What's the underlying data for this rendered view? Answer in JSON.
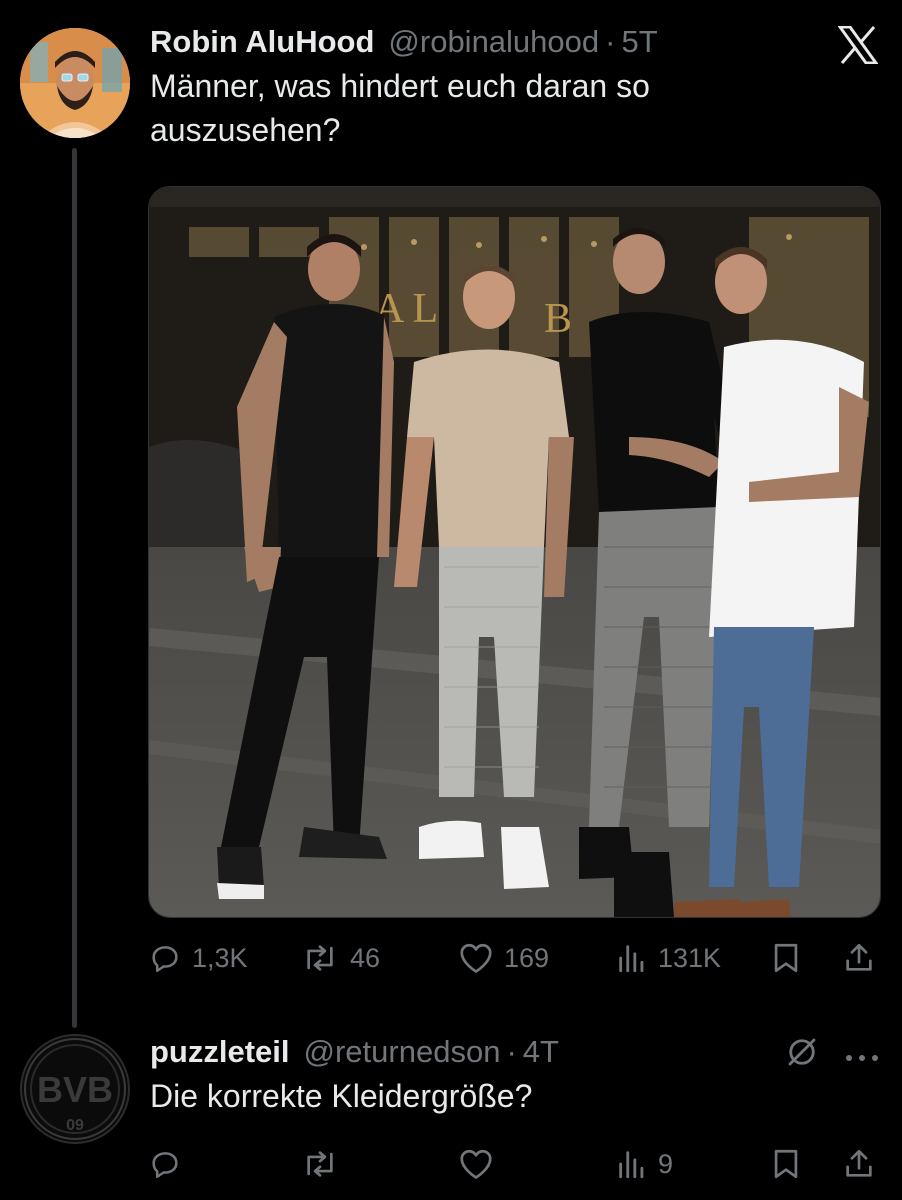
{
  "post": {
    "author_name": "Robin AluHood",
    "handle": "@robinaluhood",
    "separator": "·",
    "time": "5T",
    "text": "Männer, was hindert euch daran so auszusehen?",
    "stats": {
      "replies": "1,3K",
      "reposts": "46",
      "likes": "169",
      "views": "131K"
    }
  },
  "reply": {
    "author_name": "puzzleteil",
    "handle": "@returnedson",
    "separator": "·",
    "time": "4T",
    "text": "Die korrekte Kleidergröße?",
    "avatar_text": "BVB",
    "avatar_subtext": "09",
    "stats": {
      "replies": "",
      "reposts": "",
      "likes": "",
      "views": "9"
    }
  },
  "icons": {
    "close": "x-logo-icon",
    "reply": "reply-icon",
    "repost": "repost-icon",
    "like": "heart-icon",
    "views": "views-icon",
    "bookmark": "bookmark-icon",
    "share": "share-icon",
    "more": "more-icon",
    "grok": "grok-icon"
  },
  "colors": {
    "background": "#000000",
    "text_primary": "#e7e9ea",
    "text_secondary": "#71767b",
    "thread_line": "#333639"
  }
}
